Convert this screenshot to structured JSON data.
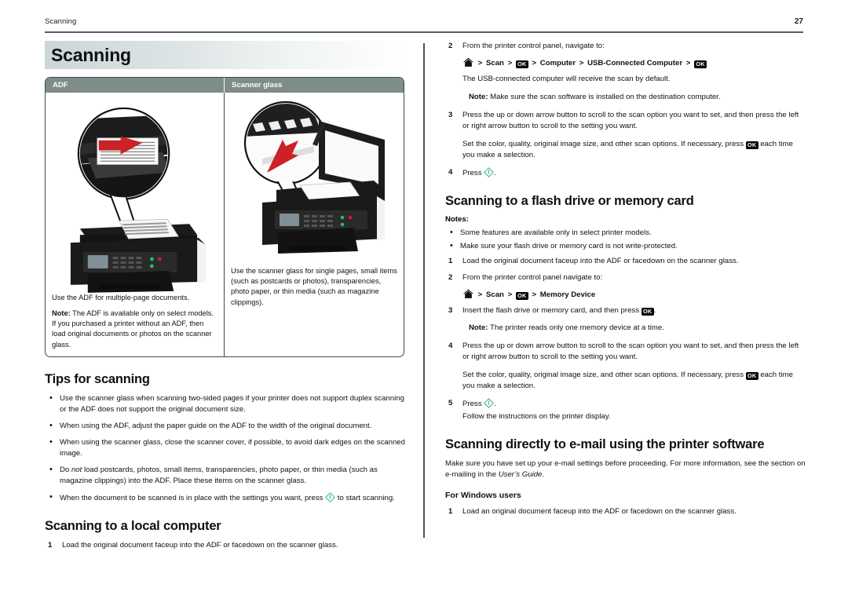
{
  "header": {
    "running_title": "Scanning",
    "page_number": "27"
  },
  "chapter": {
    "title": "Scanning"
  },
  "media_table": {
    "columns": [
      {
        "header": "ADF"
      },
      {
        "header": "Scanner glass"
      }
    ],
    "adf_cell": {
      "line1": "Use the ADF for multiple-page documents.",
      "note_label": "Note:",
      "note_text": " The ADF is available only on select models. If you purchased a printer without an ADF, then load original documents or photos on the scanner glass."
    },
    "glass_cell": {
      "line1": "Use the scanner glass for single pages, small items (such as postcards or photos), transparencies, photo paper, or thin media (such as magazine clippings)."
    }
  },
  "tips": {
    "heading": "Tips for scanning",
    "items": [
      "Use the scanner glass when scanning two-sided pages if your printer does not support duplex scanning or the ADF does not support the original document size.",
      "When using the ADF, adjust the paper guide on the ADF to the width of the original document.",
      "When using the scanner glass, close the scanner cover, if possible, to avoid dark edges on the scanned image."
    ],
    "item_do_not_prefix": "Do ",
    "item_do_not_italic": "not",
    "item_do_not_suffix": " load postcards, photos, small items, transparencies, photo paper, or thin media (such as magazine clippings) into the ADF. Place these items on the scanner glass.",
    "item_last_prefix": "When the document to be scanned is in place with the settings you want, press ",
    "item_last_suffix": " to start scanning."
  },
  "local_computer": {
    "heading": "Scanning to a local computer",
    "step1_num": "1",
    "step1_text": "Load the original document faceup into the ADF or facedown on the scanner glass.",
    "step2_num": "2",
    "step2_text": "From the printer control panel, navigate to:",
    "navpath": {
      "home_label": "home-icon",
      "item1": "Scan",
      "ok1": "OK",
      "item2": "Computer",
      "item3": "USB-Connected Computer",
      "ok2": "OK",
      "separator": ">"
    },
    "after_nav": "The USB-connected computer will receive the scan by default.",
    "note_label": "Note:",
    "note_text": " Make sure the scan software is installed on the destination computer.",
    "step3_num": "3",
    "step3_text": "Press the up or down arrow button to scroll to the scan option you want to set, and then press the left or right arrow button to scroll to the setting you want.",
    "step3_extra_prefix": "Set the color, quality, original image size, and other scan options. If necessary, press ",
    "step3_extra_ok": "OK",
    "step3_extra_suffix": " each time you make a selection.",
    "step4_num": "4",
    "step4_text_prefix": "Press ",
    "step4_text_suffix": "."
  },
  "flash_drive": {
    "heading": "Scanning to a flash drive or memory card",
    "notes_label": "Notes:",
    "notes": [
      "Some features are available only in select printer models.",
      "Make sure your flash drive or memory card is not write-protected."
    ],
    "step1_num": "1",
    "step1_text": "Load the original document faceup into the ADF or facedown on the scanner glass.",
    "step2_num": "2",
    "step2_text": "From the printer control panel navigate to:",
    "navpath": {
      "item1": "Scan",
      "ok1": "OK",
      "item2": "Memory Device",
      "separator": ">"
    },
    "step3_num": "3",
    "step3_text_prefix": "Insert the flash drive or memory card, and then press ",
    "step3_ok": "OK",
    "step3_text_suffix": ".",
    "note_label": "Note:",
    "note_text": " The printer reads only one memory device at a time.",
    "step4_num": "4",
    "step4_text": "Press the up or down arrow button to scroll to the scan option you want to set, and then press the left or right arrow button to scroll to the setting you want.",
    "step4_extra_prefix": "Set the color, quality, original image size, and other scan options. If necessary, press ",
    "step4_extra_ok": "OK",
    "step4_extra_suffix": " each time you make a selection.",
    "step5_num": "5",
    "step5_text_prefix": "Press ",
    "step5_text_suffix": ".",
    "step5_follow": "Follow the instructions on the printer display."
  },
  "email": {
    "heading": "Scanning directly to e-mail using the printer software",
    "intro_prefix": "Make sure you have set up your e-mail settings before proceeding. For more information, see the section on e-mailing in the ",
    "intro_italic": "User’s Guide",
    "intro_suffix": ".",
    "subheading": "For Windows users",
    "step1_num": "1",
    "step1_text": "Load an original document faceup into the ADF or facedown on the scanner glass."
  },
  "colors": {
    "table_header_bg": "#7e8c8a",
    "rule": "#555f63",
    "title_band_start": "#ccd6d8",
    "start_icon_green": "#2bb673",
    "arrow_red": "#cc2127"
  }
}
